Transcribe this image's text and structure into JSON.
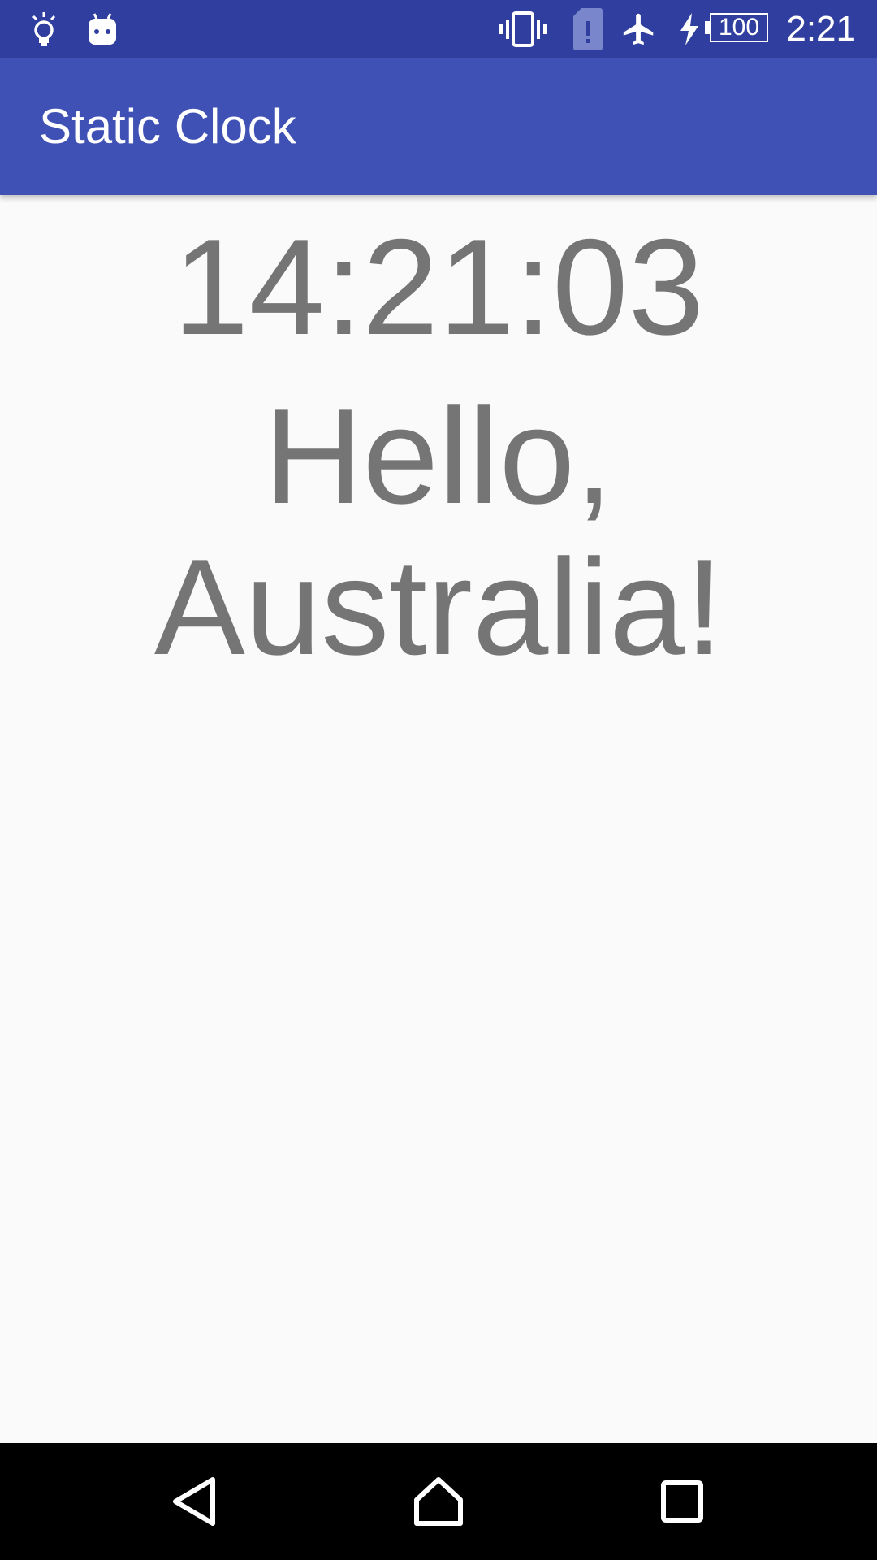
{
  "status_bar": {
    "time": "2:21",
    "battery_level": "100",
    "icons": [
      "lightbulb-icon",
      "android-icon",
      "vibrate-icon",
      "sim-alert-icon",
      "airplane-mode-icon",
      "charging-icon",
      "battery-icon"
    ]
  },
  "app_bar": {
    "title": "Static Clock",
    "color": "#3f51b5"
  },
  "main": {
    "clock": "14:21:03",
    "greeting": "Hello, Australia!",
    "text_color": "#757575"
  },
  "nav_bar": {
    "buttons": [
      "back-icon",
      "home-icon",
      "recents-icon"
    ]
  }
}
